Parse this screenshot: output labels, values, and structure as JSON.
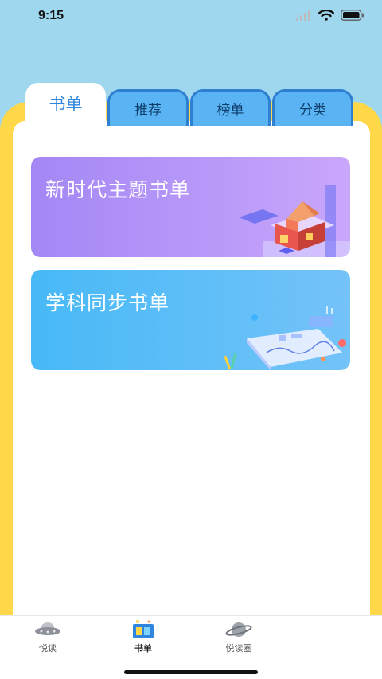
{
  "status_bar": {
    "time": "9:15"
  },
  "tabs": [
    {
      "label": "书单",
      "active": true
    },
    {
      "label": "推荐",
      "active": false
    },
    {
      "label": "榜单",
      "active": false
    },
    {
      "label": "分类",
      "active": false
    }
  ],
  "cards": [
    {
      "title": "新时代主题书单",
      "icon": "pyramid-building-illustration"
    },
    {
      "title": "学科同步书单",
      "icon": "study-documents-illustration"
    }
  ],
  "bottom_nav": [
    {
      "label": "悦读",
      "icon": "ufo-icon",
      "active": false
    },
    {
      "label": "书单",
      "icon": "book-list-icon",
      "active": true
    },
    {
      "label": "悦读圈",
      "icon": "planet-icon",
      "active": false
    }
  ],
  "colors": {
    "sky": "#9fd8ee",
    "frame": "#ffd84a",
    "tab_blue": "#5ab3f2",
    "card_purple": "#a487f5",
    "card_blue": "#47b9f6",
    "active_tab_text": "#2e86de"
  }
}
